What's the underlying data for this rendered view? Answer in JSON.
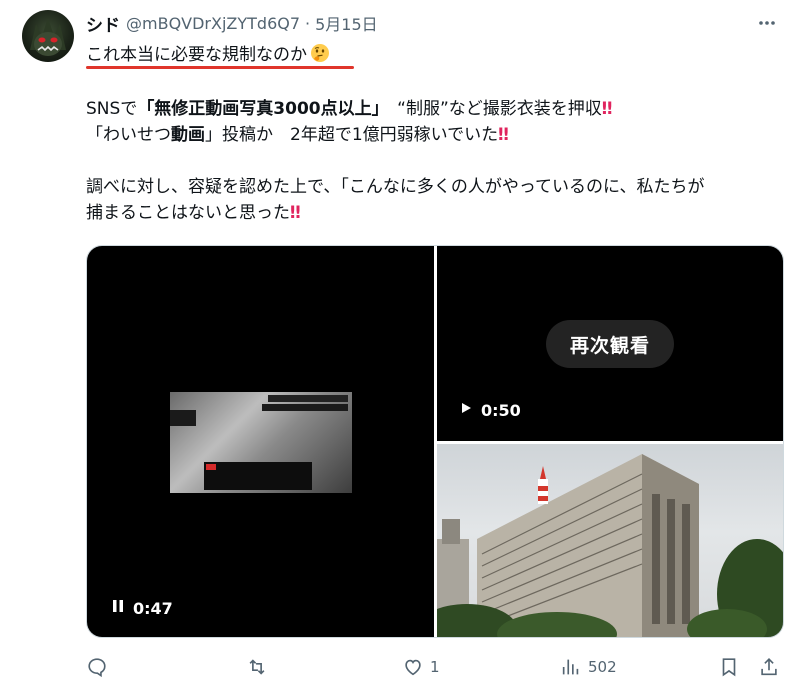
{
  "tweet": {
    "display_name": "シド",
    "handle": "@mBQVDrXjZYTd6Q7",
    "separator": "·",
    "date": "5月15日",
    "headline": "これ本当に必要な規制なのか",
    "headline_emoji": "thinking-face-emoji",
    "body": {
      "l1_a": "SNSで",
      "l1_b": "「無修正動画写真3000点以上」",
      "l1_c": "　“制服”など撮影衣装を押収",
      "l1_bang": "‼",
      "l2_a": "「わいせつ",
      "l2_b": "動画",
      "l2_c": "」投稿か　2年超で1億円弱稼いでいた",
      "l2_bang": "‼",
      "l3": "調べに対し、容疑を認めた上で、「こんなに多くの人がやっているのに、私たちが",
      "l4": "捕まることはないと思った",
      "l4_bang": "‼"
    }
  },
  "media": {
    "left_video_time": "0:47",
    "right_video_time": "0:50",
    "replay_label": "再次観看"
  },
  "actions": {
    "reply_count": "",
    "retweet_count": "",
    "like_count": "1",
    "views_count": "502"
  },
  "colors": {
    "accent_red": "#e0352b",
    "muted": "#536471"
  }
}
